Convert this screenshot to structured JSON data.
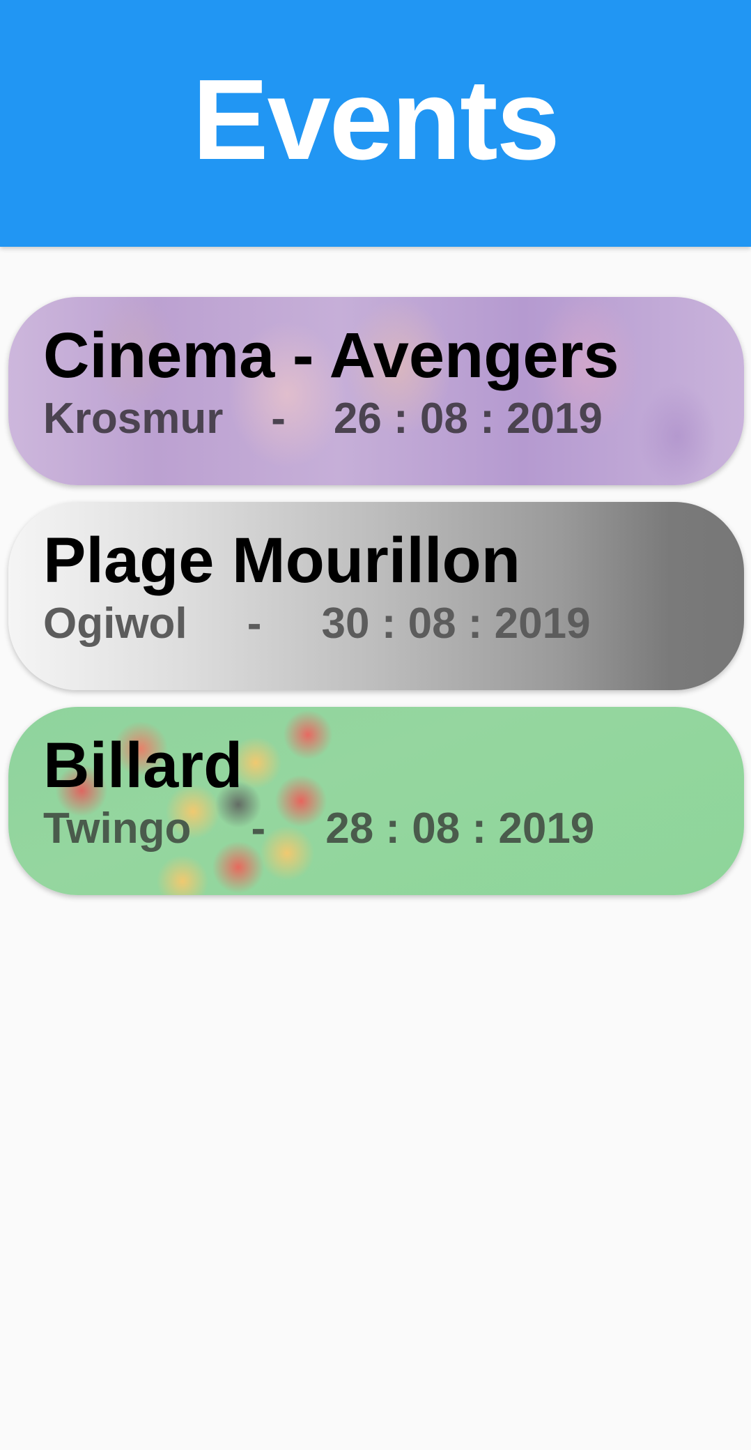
{
  "app_bar": {
    "title": "Events",
    "color": "#2196f3"
  },
  "events": [
    {
      "title": "Cinema - Avengers",
      "subtitle": "Krosmur    -    26 : 08 : 2019",
      "background": "avengers-poster-image"
    },
    {
      "title": "Plage Mourillon",
      "subtitle": "Ogiwol     -     30 : 08 : 2019",
      "background": "grey-gradient"
    },
    {
      "title": "Billard",
      "subtitle": "Twingo     -     28 : 08 : 2019",
      "background": "billiard-balls-image"
    }
  ]
}
